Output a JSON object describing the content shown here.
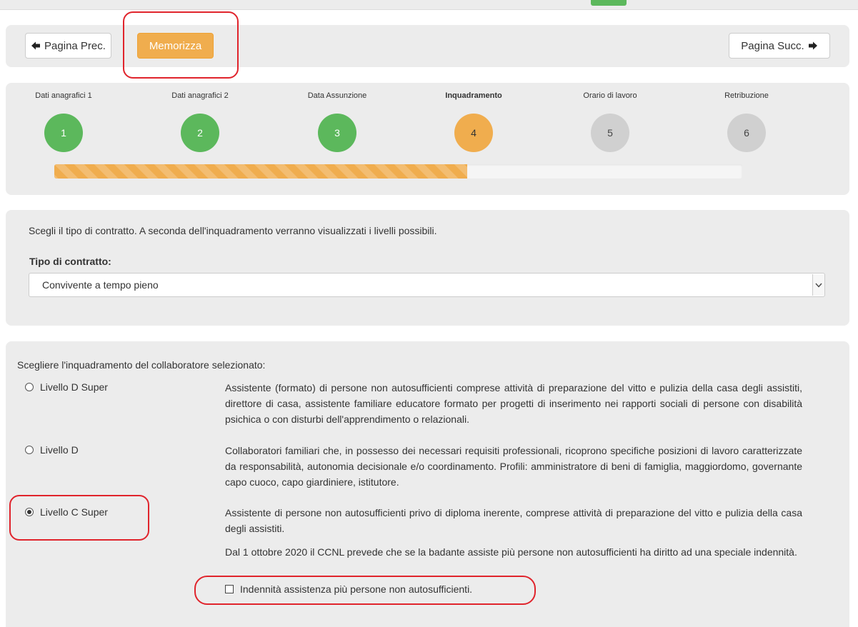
{
  "nav": {
    "prev_label": "Pagina Prec.",
    "save_label": "Memorizza",
    "next_label": "Pagina Succ."
  },
  "steps": [
    {
      "label": "Dati anagrafici 1",
      "number": "1",
      "status": "done"
    },
    {
      "label": "Dati anagrafici 2",
      "number": "2",
      "status": "done"
    },
    {
      "label": "Data Assunzione",
      "number": "3",
      "status": "done"
    },
    {
      "label": "Inquadramento",
      "number": "4",
      "status": "active"
    },
    {
      "label": "Orario di lavoro",
      "number": "5",
      "status": "todo"
    },
    {
      "label": "Retribuzione",
      "number": "6",
      "status": "todo"
    }
  ],
  "progress": {
    "percent": 60
  },
  "contract": {
    "intro": "Scegli il tipo di contratto. A seconda dell'inquadramento verranno visualizzati i livelli possibili.",
    "label": "Tipo di contratto:",
    "selected": "Convivente a tempo pieno"
  },
  "levels": {
    "title": "Scegliere l'inquadramento del collaboratore selezionato:",
    "options": [
      {
        "label": "Livello D Super",
        "checked": false,
        "description": "Assistente (formato) di persone non autosufficienti comprese attività di preparazione del vitto e pulizia della casa degli assistiti, direttore di casa, assistente familiare educatore formato per progetti di inserimento nei rapporti sociali di persone con disabilità psichica o con disturbi dell'apprendimento o relazionali."
      },
      {
        "label": "Livello D",
        "checked": false,
        "description": "Collaboratori familiari che, in possesso dei necessari requisiti professionali, ricoprono specifiche posizioni di lavoro caratterizzate da responsabilità, autonomia decisionale e/o coordinamento. Profili: amministratore di beni di famiglia, maggiordomo, governante capo cuoco, capo giardiniere, istitutore."
      },
      {
        "label": "Livello C Super",
        "checked": true,
        "description": "Assistente di persone non autosufficienti privo di diploma inerente, comprese attività di preparazione del vitto e pulizia della casa degli assistiti."
      }
    ],
    "note": "Dal 1 ottobre 2020 il CCNL prevede che se la badante assiste più persone non autosufficienti ha diritto ad una speciale indennità.",
    "checkbox_label": "Indennità assistenza più persone non autosufficienti.",
    "checkbox_checked": false
  },
  "colors": {
    "done": "#5cb85c",
    "active": "#f0ad4e",
    "todo": "#d0d0d0",
    "highlight": "#e0242c"
  }
}
